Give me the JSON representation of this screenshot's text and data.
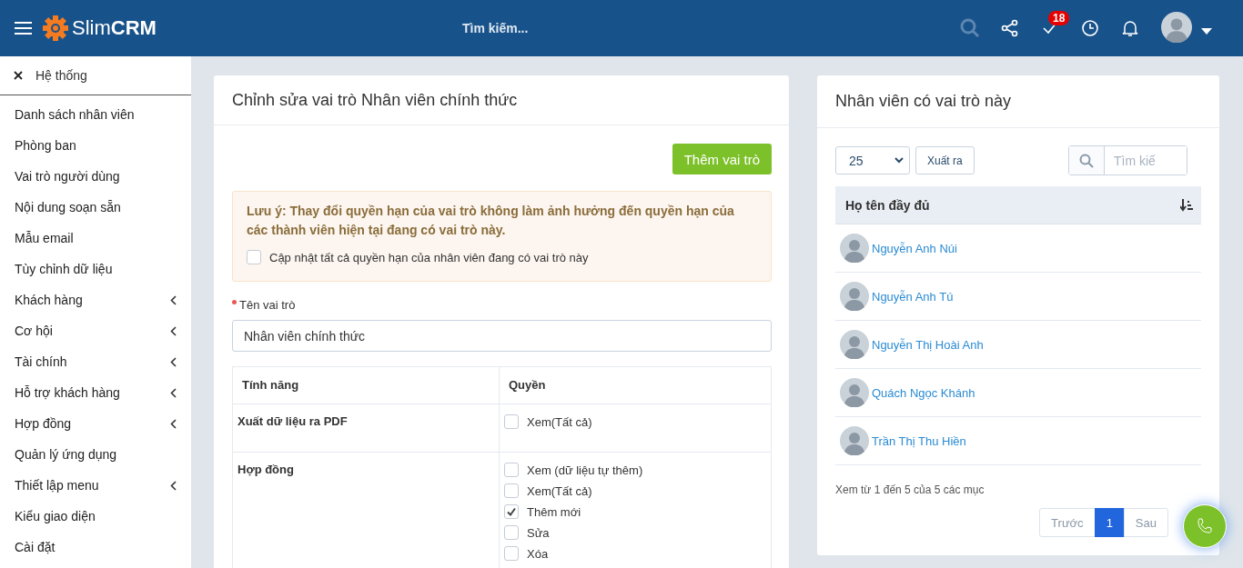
{
  "header": {
    "logo_light": "Slim",
    "logo_bold": "CRM",
    "search_placeholder": "Tìm kiếm...",
    "task_count": "18"
  },
  "sidebar": {
    "close_label": "Hệ thống",
    "items": [
      {
        "label": "Danh sách nhân viên",
        "has_submenu": false
      },
      {
        "label": "Phòng ban",
        "has_submenu": false
      },
      {
        "label": "Vai trò người dùng",
        "has_submenu": false
      },
      {
        "label": "Nội dung soạn sẵn",
        "has_submenu": false
      },
      {
        "label": "Mẫu email",
        "has_submenu": false
      },
      {
        "label": "Tùy chỉnh dữ liệu",
        "has_submenu": false
      },
      {
        "label": "Khách hàng",
        "has_submenu": true
      },
      {
        "label": "Cơ hội",
        "has_submenu": true
      },
      {
        "label": "Tài chính",
        "has_submenu": true
      },
      {
        "label": "Hỗ trợ khách hàng",
        "has_submenu": true
      },
      {
        "label": "Hợp đồng",
        "has_submenu": true
      },
      {
        "label": "Quản lý ứng dụng",
        "has_submenu": false
      },
      {
        "label": "Thiết lập menu",
        "has_submenu": true
      },
      {
        "label": "Kiểu giao diện",
        "has_submenu": false
      },
      {
        "label": "Cài đặt",
        "has_submenu": false
      }
    ]
  },
  "role_form": {
    "title": "Chỉnh sửa vai trò Nhân viên chính thức",
    "add_button": "Thêm vai trò",
    "notice": {
      "text": "Lưu ý: Thay đổi quyền hạn của vai trò không làm ảnh hưởng đến quyền hạn của các thành viên hiện tại đang có vai trò này.",
      "checkbox": {
        "label": "Cập nhật tất cả quyền hạn của nhân viên đang có vai trò này",
        "checked": false
      }
    },
    "name_field": {
      "label": "Tên vai trò",
      "value": "Nhân viên chính thức"
    },
    "permissions": {
      "columns": [
        "Tính năng",
        "Quyền"
      ],
      "rows": [
        {
          "feature": "Xuất dữ liệu ra PDF",
          "options": [
            {
              "label": "Xem(Tất cả)",
              "checked": false
            }
          ]
        },
        {
          "feature": "Hợp đồng",
          "options": [
            {
              "label": "Xem (dữ liệu tự thêm)",
              "checked": false
            },
            {
              "label": "Xem(Tất cả)",
              "checked": false
            },
            {
              "label": "Thêm mới",
              "checked": true
            },
            {
              "label": "Sửa",
              "checked": false
            },
            {
              "label": "Xóa",
              "checked": false
            }
          ]
        }
      ]
    }
  },
  "members_panel": {
    "title": "Nhân viên có vai trò này",
    "page_size": "25",
    "export_button": "Xuất ra",
    "search_placeholder": "Tìm kiế",
    "column": "Họ tên đầy đủ",
    "members": [
      {
        "name": "Nguyễn Anh Núi"
      },
      {
        "name": "Nguyễn Anh Tú"
      },
      {
        "name": "Nguyễn Thị Hoài Anh"
      },
      {
        "name": "Quách Ngọc Khánh"
      },
      {
        "name": "Trần Thị Thu Hiền"
      }
    ],
    "summary": "Xem từ 1 đến 5 của 5 các mục",
    "pagination": [
      {
        "label": "Trước",
        "selected": false
      },
      {
        "label": "1",
        "selected": true
      },
      {
        "label": "Sau",
        "selected": false
      }
    ]
  }
}
